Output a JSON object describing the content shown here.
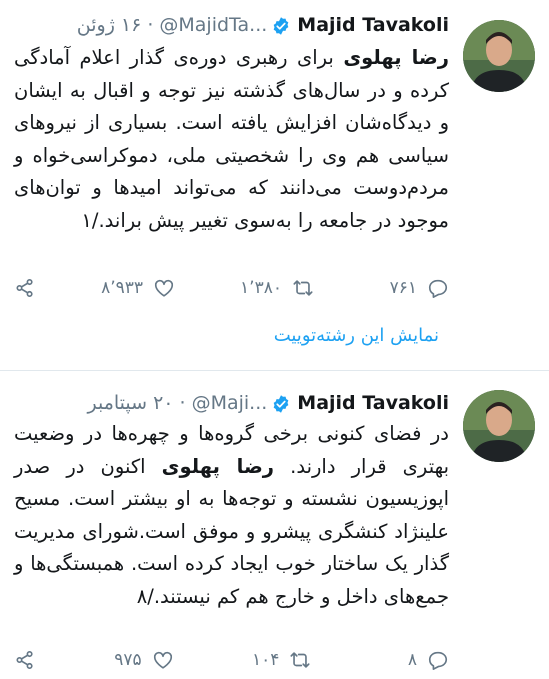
{
  "tweets": [
    {
      "author_name": "Majid Tavakoli",
      "handle": "@MajidTa...",
      "separator": "·",
      "date": "۱۶ ژوئن",
      "body": {
        "mention": "رضا پهلوی",
        "text": " برای رهبری دوره‌ی گذار اعلام آمادگی کرده و در سال‌های گذشته نیز توجه و اقبال به ایشان و دیدگاه‌شان افزایش یافته است. بسیاری از نیروهای سیاسی هم وی را شخصیتی ملی، دموکراسی‌خواه و مردم‌دوست می‌دانند که می‌تواند امیدها و توان‌های موجود در جامعه را به‌سوی تغییر پیش براند./۱"
      },
      "actions": {
        "reply_count": "۷۶۱",
        "retweet_count": "۱٬۳۸۰",
        "like_count": "۸٬۹۳۳"
      },
      "show_thread": "نمایش این رشته‌توییت"
    },
    {
      "author_name": "Majid Tavakoli",
      "handle": "@Maji...",
      "separator": "·",
      "date": "۲۰ سپتامبر",
      "body": {
        "before": "در فضای کنونی برخی گروه‌ها و چهره‌ها در وضعیت بهتری قرار دارند. ",
        "mention": "رضا پهلوی",
        "after": " اکنون در صدر اپوزیسیون نشسته و توجه‌ها به او بیشتر است. مسیح علینژاد کنشگری پیشرو و موفق است.شورای مدیریت گذار یک ساختار خوب ایجاد کرده است. همبستگی‌ها و جمع‌های داخل و خارج هم کم نیستند./۸"
      },
      "actions": {
        "reply_count": "۸",
        "retweet_count": "۱۰۴",
        "like_count": "۹۷۵"
      }
    }
  ],
  "colors": {
    "text": "#14171a",
    "secondary": "#657786",
    "link": "#1da1f2",
    "verified": "#1da1f2",
    "divider": "#e1e8ed"
  },
  "icons": {
    "verified": "verified-badge-icon",
    "reply": "reply-bubble-icon",
    "retweet": "retweet-arrows-icon",
    "like": "heart-icon",
    "share": "share-icon"
  }
}
